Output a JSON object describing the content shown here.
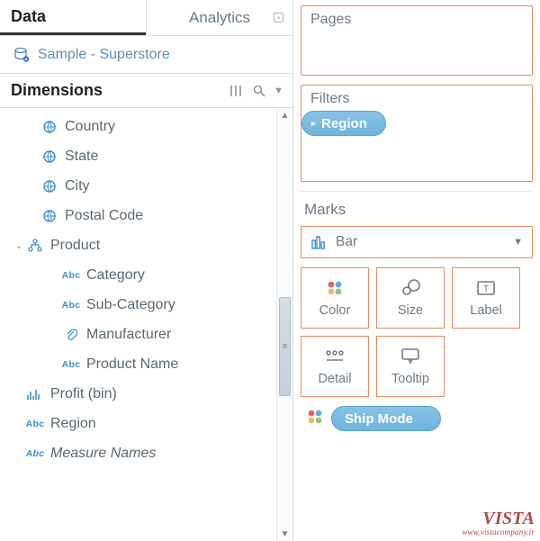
{
  "tabs": {
    "data": "Data",
    "analytics": "Analytics"
  },
  "datasource": {
    "name": "Sample - Superstore"
  },
  "dimensions": {
    "title": "Dimensions",
    "fields": [
      {
        "label": "Country"
      },
      {
        "label": "State"
      },
      {
        "label": "City"
      },
      {
        "label": "Postal Code"
      }
    ],
    "product": {
      "label": "Product",
      "children": [
        {
          "label": "Category"
        },
        {
          "label": "Sub-Category"
        },
        {
          "label": "Manufacturer"
        },
        {
          "label": "Product Name"
        }
      ]
    },
    "tail": [
      {
        "label": "Profit (bin)"
      },
      {
        "label": "Region"
      },
      {
        "label": "Measure Names"
      }
    ]
  },
  "shelves": {
    "pages": "Pages",
    "filters": "Filters",
    "filter_pill": "Region"
  },
  "marks": {
    "title": "Marks",
    "type": "Bar",
    "buttons": {
      "color": "Color",
      "size": "Size",
      "label": "Label",
      "detail": "Detail",
      "tooltip": "Tooltip"
    },
    "ship_pill": "Ship Mode"
  },
  "watermark": {
    "brand": "VISTA",
    "url": "www.vistacompany.ir"
  }
}
